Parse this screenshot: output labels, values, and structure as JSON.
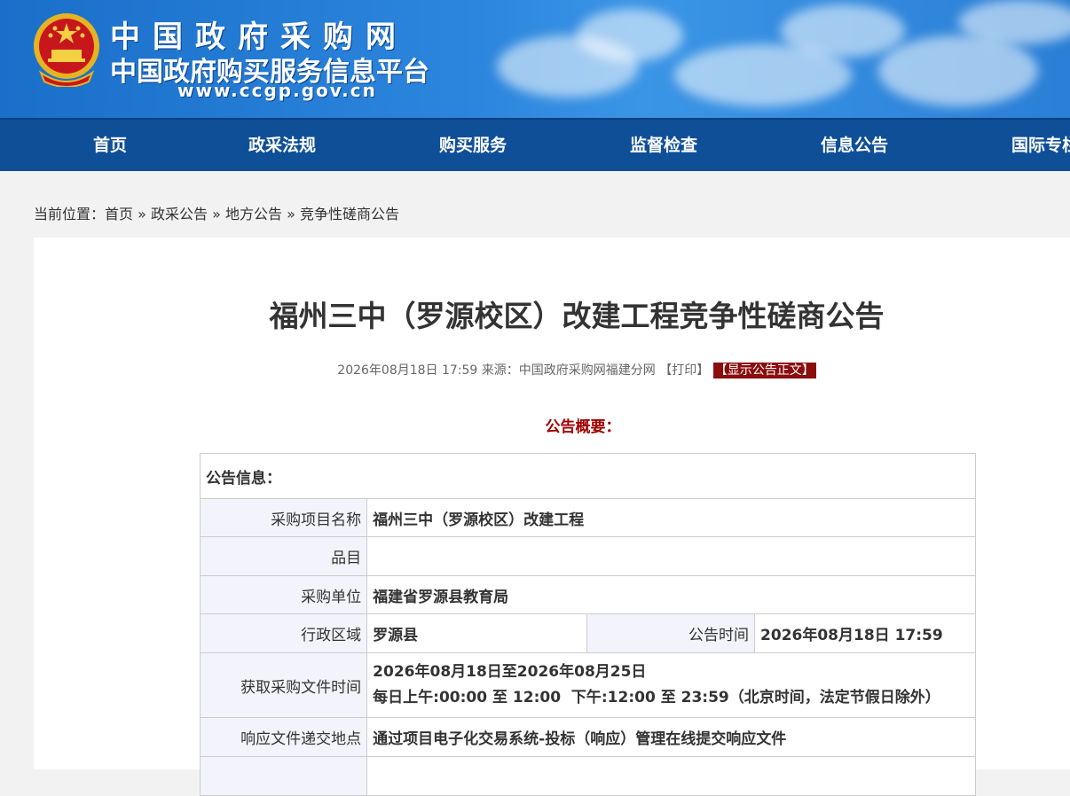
{
  "header": {
    "title_line1": "中国政府采购网",
    "title_line2": "中国政府购买服务信息平台",
    "url": "www.ccgp.gov.cn"
  },
  "nav": [
    "首页",
    "政采法规",
    "购买服务",
    "监督检查",
    "信息公告",
    "国际专栏"
  ],
  "breadcrumb": {
    "prefix": "当前位置：",
    "items": [
      "首页",
      "政采公告",
      "地方公告",
      "竞争性磋商公告"
    ],
    "sep": "»"
  },
  "article": {
    "title": "福州三中（罗源校区）改建工程竞争性磋商公告",
    "date": "2026年08月18日 17:59",
    "source_label": "来源：",
    "source": "中国政府采购网福建分网",
    "print": "【打印】",
    "show_text": "【显示公告正文】",
    "summary_heading": "公告概要："
  },
  "table": {
    "section_heading": "公告信息：",
    "rows": {
      "project_name_label": "采购项目名称",
      "project_name": "福州三中（罗源校区）改建工程",
      "category_label": "品目",
      "category": "",
      "purchaser_label": "采购单位",
      "purchaser": "福建省罗源县教育局",
      "region_label": "行政区域",
      "region": "罗源县",
      "announce_time_label": "公告时间",
      "announce_time": "2026年08月18日 17:59",
      "obtain_time_label": "获取采购文件时间",
      "obtain_time_line1": "2026年08月18日至2026年08月25日",
      "obtain_time_line2": "每日上午:00:00 至 12:00  下午:12:00 至 23:59（北京时间，法定节假日除外）",
      "submit_place_label": "响应文件递交地点",
      "submit_place": "通过项目电子化交易系统-投标（响应）管理在线提交响应文件"
    }
  },
  "colors": {
    "nav_bg": "#0f4f98",
    "accent_red": "#a00000",
    "show_btn_bg": "#8b0d0d",
    "label_bg": "#f3f3fb"
  }
}
